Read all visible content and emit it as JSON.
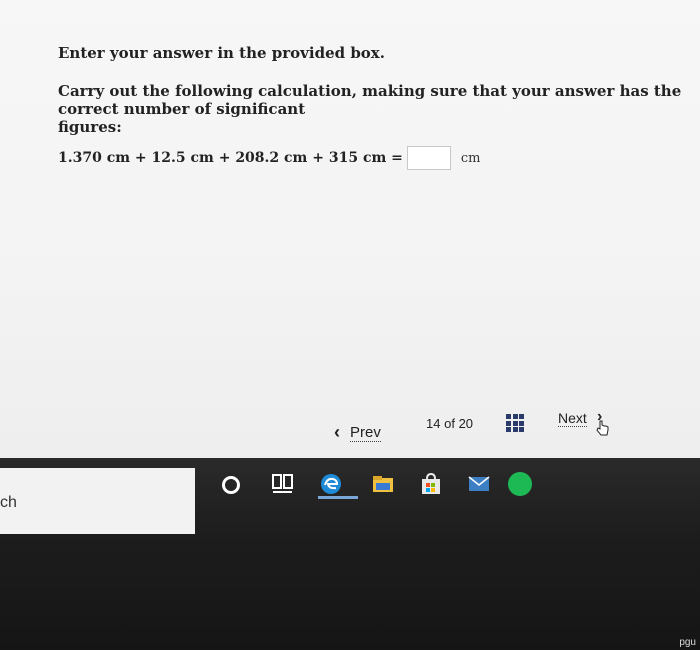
{
  "question": {
    "instruction": "Enter your answer in the provided box.",
    "prompt_line1": "Carry out the following calculation, making sure that your answer has the correct number of significant",
    "prompt_line2": "figures:",
    "calculation": "1.370 cm + 12.5 cm + 208.2 cm + 315 cm =",
    "answer_value": "",
    "unit": "cm"
  },
  "nav": {
    "prev_label": "Prev",
    "counter_current": "14",
    "counter_of": "of",
    "counter_total": "20",
    "next_label": "Next"
  },
  "taskbar": {
    "search_text": "ch",
    "corner_text": "pgu",
    "icons": [
      "cortana-icon",
      "task-view-icon",
      "edge-icon",
      "file-explorer-icon",
      "store-icon",
      "mail-icon",
      "spotify-icon"
    ]
  },
  "colors": {
    "grid_icon": "#2a3a6a",
    "spotify": "#1db954",
    "edge": "#1f8ad6",
    "active_bar": "#7aa7d6"
  }
}
